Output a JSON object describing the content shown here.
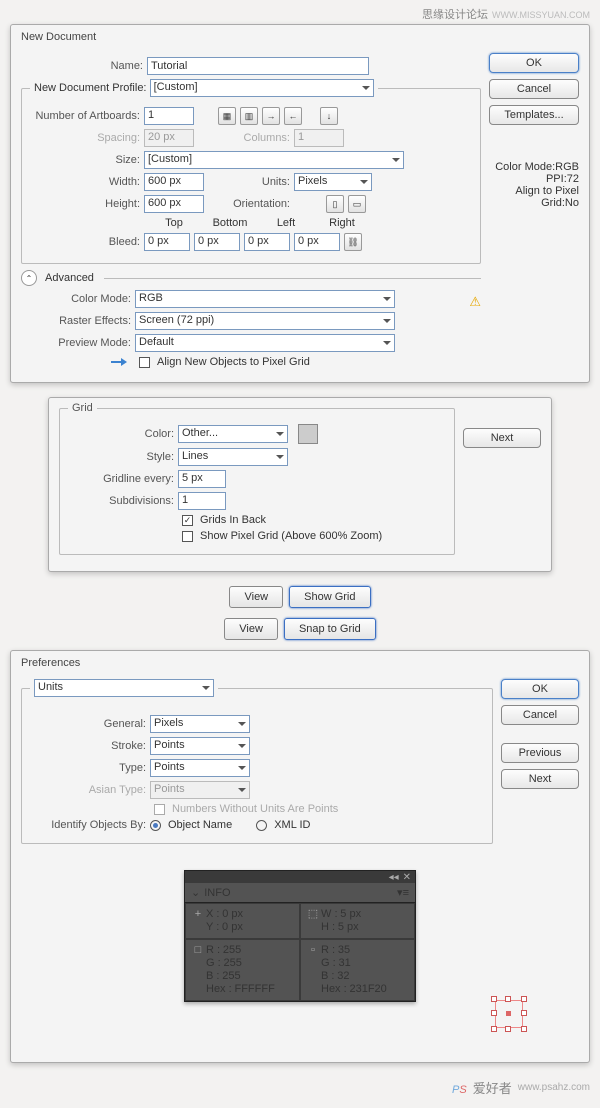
{
  "watermark": {
    "cn": "思缘设计论坛",
    "en": "WWW.MISSYUAN.COM"
  },
  "newdoc": {
    "title": "New Document",
    "name_lbl": "Name:",
    "name": "Tutorial",
    "profile_legend": "New Document Profile:",
    "profile": "[Custom]",
    "artboards_lbl": "Number of Artboards:",
    "artboards": "1",
    "spacing_lbl": "Spacing:",
    "spacing": "20 px",
    "columns_lbl": "Columns:",
    "columns": "1",
    "size_lbl": "Size:",
    "size": "[Custom]",
    "width_lbl": "Width:",
    "width": "600 px",
    "units_lbl": "Units:",
    "units": "Pixels",
    "height_lbl": "Height:",
    "height": "600 px",
    "orient_lbl": "Orientation:",
    "bleed_lbl": "Bleed:",
    "top": "Top",
    "bottom": "Bottom",
    "left": "Left",
    "right": "Right",
    "bt": "0 px",
    "bb": "0 px",
    "bl": "0 px",
    "br": "0 px",
    "advanced": "Advanced",
    "cmode_lbl": "Color Mode:",
    "cmode": "RGB",
    "raster_lbl": "Raster Effects:",
    "raster": "Screen (72 ppi)",
    "preview_lbl": "Preview Mode:",
    "preview": "Default",
    "align_chk": "Align New Objects to Pixel Grid",
    "ok": "OK",
    "cancel": "Cancel",
    "templates": "Templates...",
    "info1": "Color Mode:RGB",
    "info2": "PPI:72",
    "info3": "Align to Pixel Grid:No"
  },
  "grid": {
    "legend": "Grid",
    "color_lbl": "Color:",
    "color": "Other...",
    "style_lbl": "Style:",
    "style": "Lines",
    "every_lbl": "Gridline every:",
    "every": "5 px",
    "sub_lbl": "Subdivisions:",
    "sub": "1",
    "back_chk": "Grids In Back",
    "pixel_chk": "Show Pixel Grid (Above 600% Zoom)",
    "next": "Next"
  },
  "buttons": {
    "view": "View",
    "showgrid": "Show Grid",
    "snap": "Snap to Grid"
  },
  "prefs": {
    "title": "Preferences",
    "cat": "Units",
    "gen_lbl": "General:",
    "gen": "Pixels",
    "str_lbl": "Stroke:",
    "str": "Points",
    "type_lbl": "Type:",
    "type": "Points",
    "asian_lbl": "Asian Type:",
    "asian": "Points",
    "nwu": "Numbers Without Units Are Points",
    "ident_lbl": "Identify Objects By:",
    "objname": "Object Name",
    "xmlid": "XML ID",
    "ok": "OK",
    "cancel": "Cancel",
    "prev": "Previous",
    "next": "Next"
  },
  "info": {
    "title": "INFO",
    "x": "X :",
    "y": "Y :",
    "w": "W :",
    "h": "H :",
    "xv": "0 px",
    "yv": "0 px",
    "wv": "5 px",
    "hv": "5 px",
    "r": "R :",
    "g": "G :",
    "b": "B :",
    "hex": "Hex :",
    "r1": "255",
    "g1": "255",
    "b1": "255",
    "hx1": "FFFFFF",
    "r2": "35",
    "g2": "31",
    "b2": "32",
    "hx2": "231F20"
  },
  "footer": {
    "brand": "爱好者",
    "url": "www.psahz.com"
  }
}
